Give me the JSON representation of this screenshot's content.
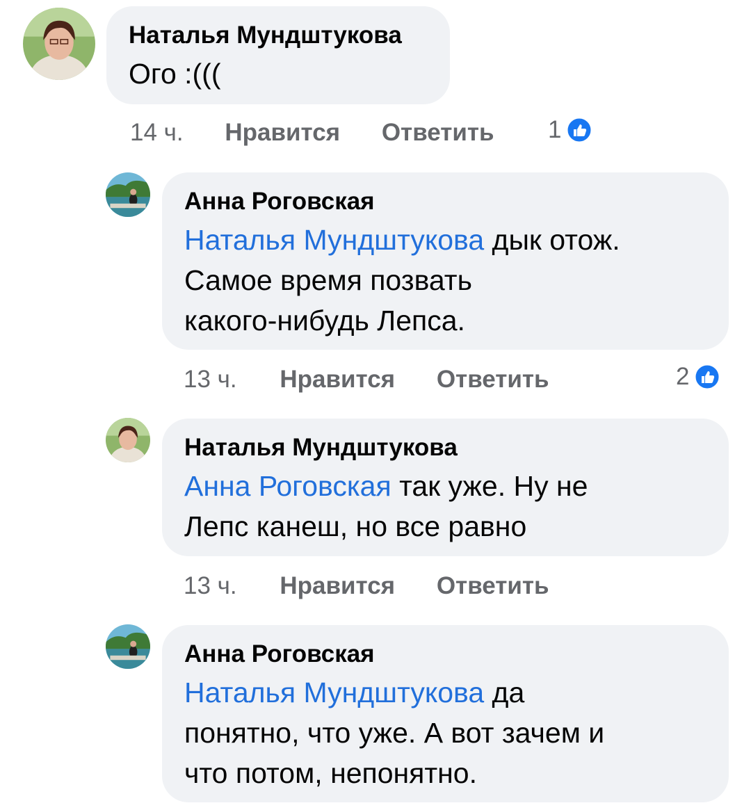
{
  "comments": [
    {
      "author": "Наталья Мундштукова",
      "mention": "",
      "text": "Ого :(((",
      "time": "14 ч.",
      "like_label": "Нравится",
      "reply_label": "Ответить",
      "reactions": "1",
      "avatar": "natalya-avatar"
    },
    {
      "author": "Анна Роговская",
      "mention": "Наталья Мундштукова",
      "text_line1_rest": " дык отож.",
      "text_line2": "Самое время позвать",
      "text_line3": "какого-нибудь Лепса.",
      "time": "13 ч.",
      "like_label": "Нравится",
      "reply_label": "Ответить",
      "reactions": "2",
      "avatar": "anna-avatar"
    },
    {
      "author": "Наталья Мундштукова",
      "mention": "Анна Роговская",
      "text_line1_rest": " так уже. Ну не",
      "text_line2": "Лепс канеш, но все равно",
      "time": "13 ч.",
      "like_label": "Нравится",
      "reply_label": "Ответить",
      "avatar": "natalya-avatar"
    },
    {
      "author": "Анна Роговская",
      "mention": "Наталья Мундштукова",
      "text_line1_rest": " да",
      "text_line2": "понятно, что уже. А вот зачем и",
      "text_line3": "что потом, непонятно.",
      "avatar": "anna-avatar"
    }
  ],
  "colors": {
    "bubble": "#f0f2f5",
    "mention": "#216fdb",
    "meta": "#65676b",
    "like_blue": "#1877f2"
  }
}
